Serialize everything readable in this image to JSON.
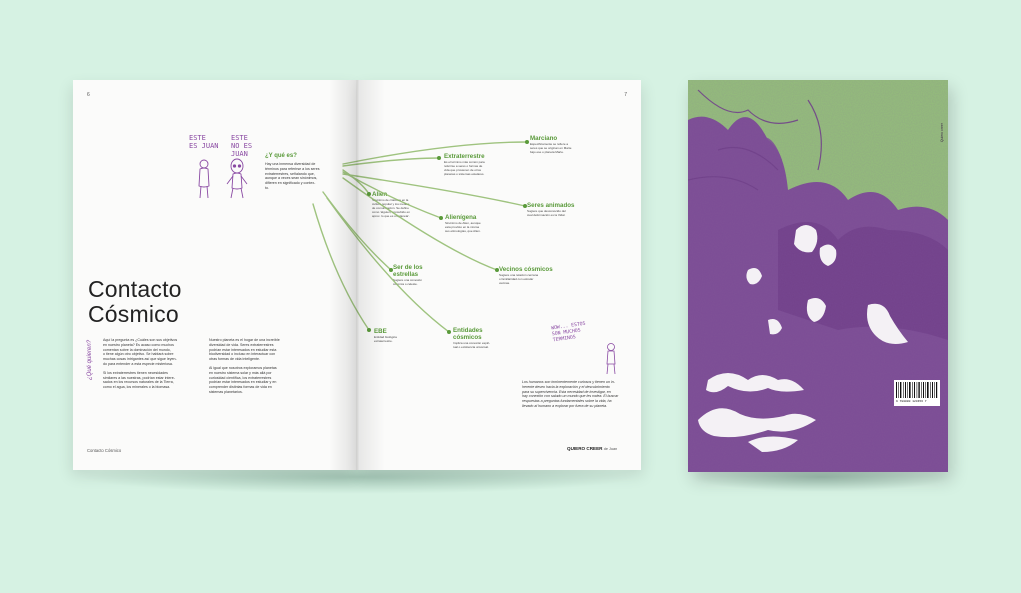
{
  "colors": {
    "background": "#d6f2e3",
    "accent_green": "#5a9a3a",
    "accent_purple": "#8a4aa3",
    "cover_green": "#94c07a",
    "cover_purple": "#7c4d95"
  },
  "left_page": {
    "page_number": "6",
    "doodle_label_1": [
      "ESTE",
      "ES JUAN"
    ],
    "doodle_label_2": [
      "ESTE",
      "NO ES",
      "JUAN"
    ],
    "question_title": "¿Y qué es?",
    "question_text": [
      "Hay una inmensa diversidad de",
      "términos para referirse a los seres",
      "extraterrestres, señalando que,",
      "aunque a veces sean sinónimos,",
      "difieren en significado y contex-",
      "to."
    ],
    "title": [
      "Contacto",
      "Cósmico"
    ],
    "side_label": "¿Qué quieren?",
    "col1": [
      "Aquí la pregunta es ¿Cuáles son sus objetivos",
      "en nuestro planeta? Es acaso como muchos",
      "comentan sobre la dominación del mundo,",
      "o tiene algún otro objetivo. Se hablará sobre",
      "muchas cosas intrigantes así que sigue leyen-",
      "do para entender a esta especie misteriosa.",
      "",
      "Si los extraterrestres tienen necesidades",
      "similares a las nuestras, podrían estar intere-",
      "sados en los recursos naturales de la Tierra,",
      "como el agua, los minerales o la biomasa."
    ],
    "col2": [
      "Nuestro planeta es el hogar de una increíble",
      "diversidad de vida. Seres extraterrestres",
      "podrían estar interesados en estudiar esta",
      "biodiversidad o incluso en interactuar con",
      "otras formas de vida inteligente.",
      "",
      "Al igual que nosotros exploramos planetas",
      "en nuestro sistema solar y más allá por",
      "curiosidad científica, los extraterrestres",
      "podrían estar interesados en estudiar y en",
      "comprender distintas formas de vida en",
      "sistemas planetarios."
    ],
    "footer": "Contacto Cósmico"
  },
  "right_page": {
    "page_number": "7",
    "terms": [
      {
        "name": "Marciano",
        "desc": [
          "Específicamente se refiere a",
          "seres que se originan en Marte",
          "bajo ese o planeta Marte."
        ]
      },
      {
        "name": "Extraterrestre",
        "desc": [
          "Es el término más común para",
          "referirse a seres o formas de",
          "vida que provienen de otros",
          "planetas o sistemas estelares."
        ]
      },
      {
        "name": "Alien",
        "desc": [
          "Sinónimo de criaturas en la",
          "cultura popular y los medios",
          "de comunicación. Se define",
          "como 'alguien, concebido en",
          "aprox. lo que es un planeta'."
        ]
      },
      {
        "name": "Alienígena",
        "desc": [
          "Sinónimo de Alien, aunque",
          "esta provisto en la misma",
          "sus etimologías, que Alien."
        ]
      },
      {
        "name": "Seres animados",
        "desc": [
          "Sugiere que desconocido del",
          "cual deformación es la Vidal."
        ]
      },
      {
        "name": "Ser de los estrellas",
        "desc": [
          "Sugiere una conexión",
          "cósmica o celeste."
        ]
      },
      {
        "name": "Vecinos cósmicos",
        "desc": [
          "Sugiere una relación cercana",
          "o familiaridad con estrelar",
          "vecinas."
        ]
      },
      {
        "name": "EBE",
        "desc": [
          "Entidad biológica",
          "extraterrestre."
        ]
      },
      {
        "name": "Entidades cósmicos",
        "desc": [
          "Implica una conexión espiri-",
          "tual o existiencia universal."
        ]
      }
    ],
    "doodle_note": [
      "WOW... ESTOS",
      "SON MUCHOS",
      "TERMINOS"
    ],
    "closing_text": [
      "Los humanos son inminentemente curiosos y tienen un in-",
      "herente deseo hacia la exploración y el descubrimiento",
      "para su supervivencia. Esta necesidad de investigar, en",
      "hay conexión con saludo un mundo que les rodea. El buscar",
      "respuestas a preguntas fundamentales sobre la vida, ha",
      "llevado al humano a explorar por fuera de su planeta."
    ],
    "footer_brand": "QUIERO CREER",
    "footer_author": "de Juan"
  },
  "back_cover": {
    "spine_text": "Quiero creer",
    "barcode_number": "9 780000 123456 7"
  }
}
